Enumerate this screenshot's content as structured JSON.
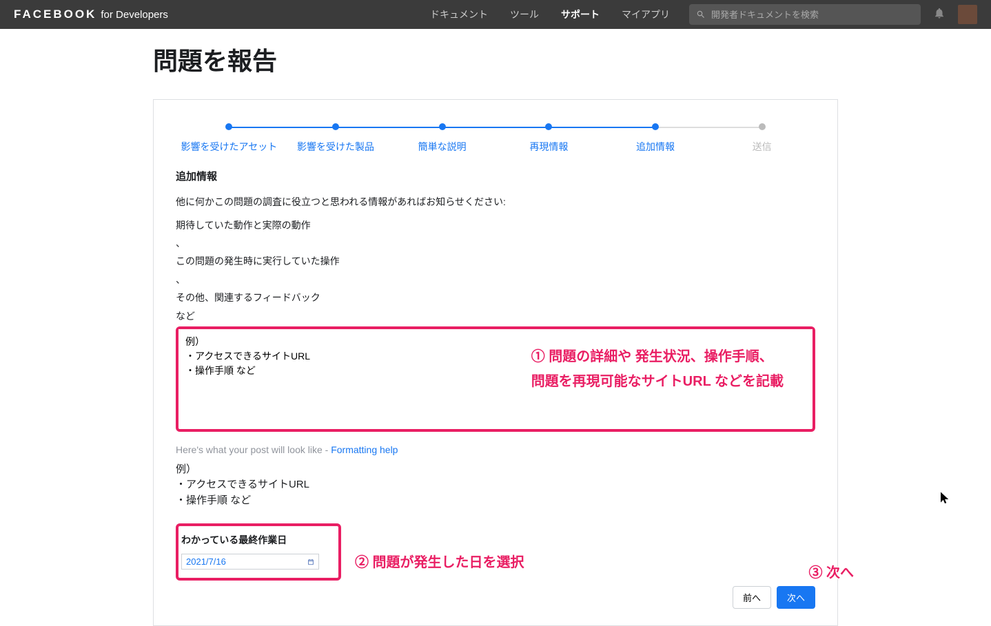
{
  "navbar": {
    "brand_main": "FACEBOOK",
    "brand_sub": "for Developers",
    "links": {
      "docs": "ドキュメント",
      "tools": "ツール",
      "support": "サポート",
      "myapps": "マイアプリ"
    },
    "search_placeholder": "開発者ドキュメントを検索"
  },
  "page": {
    "title": "問題を報告"
  },
  "stepper": {
    "s1": "影響を受けたアセット",
    "s2": "影響を受けた製品",
    "s3": "簡単な説明",
    "s4": "再現情報",
    "s5": "追加情報",
    "s6": "送信"
  },
  "section": {
    "title": "追加情報",
    "intro": "他に何かこの問題の調査に役立つと思われる情報があればお知らせください:",
    "l1": "期待していた動作と実際の動作",
    "c1": "、",
    "l2": "この問題の発生時に実行していた操作",
    "c2": "、",
    "l3": "その他、関連するフィードバック",
    "l4": "など"
  },
  "textarea": {
    "content": "例）\n・アクセスできるサイトURL\n・操作手順 など"
  },
  "annotations": {
    "a1_line1": "① 問題の詳細や 発生状況、操作手順、",
    "a1_line2": "問題を再現可能なサイトURL などを記載",
    "a2": "② 問題が発生した日を選択",
    "a3": "③ 次へ"
  },
  "preview": {
    "label_prefix": "Here's what your post will look like - ",
    "label_link": "Formatting help",
    "line1": "例）",
    "line2": "・アクセスできるサイトURL",
    "line3": "・操作手順 など"
  },
  "date": {
    "label": "わかっている最終作業日",
    "value": "2021/7/16"
  },
  "buttons": {
    "prev": "前へ",
    "next": "次へ"
  }
}
